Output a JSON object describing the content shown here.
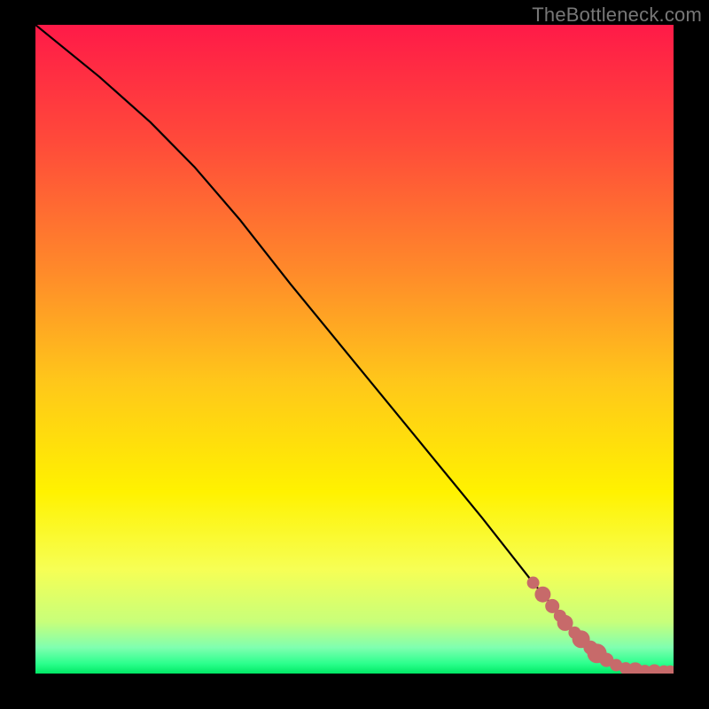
{
  "watermark": "TheBottleneck.com",
  "gradient": {
    "stops": [
      {
        "offset": 0.0,
        "color": "#ff1a48"
      },
      {
        "offset": 0.18,
        "color": "#ff4a3a"
      },
      {
        "offset": 0.38,
        "color": "#ff8a2a"
      },
      {
        "offset": 0.55,
        "color": "#ffc71a"
      },
      {
        "offset": 0.72,
        "color": "#fff200"
      },
      {
        "offset": 0.84,
        "color": "#f6ff55"
      },
      {
        "offset": 0.92,
        "color": "#c8ff7a"
      },
      {
        "offset": 0.96,
        "color": "#7fffb0"
      },
      {
        "offset": 0.985,
        "color": "#2bff8c"
      },
      {
        "offset": 1.0,
        "color": "#00e865"
      }
    ]
  },
  "chart_data": {
    "type": "line",
    "title": "",
    "xlabel": "",
    "ylabel": "",
    "xlim": [
      0,
      100
    ],
    "ylim": [
      0,
      100
    ],
    "series": [
      {
        "name": "curve",
        "x": [
          0,
          10,
          18,
          25,
          32,
          40,
          50,
          60,
          70,
          78,
          84,
          88,
          92,
          95,
          100
        ],
        "y": [
          100,
          92,
          85,
          78,
          70,
          60,
          48,
          36,
          24,
          14,
          7,
          3,
          0.8,
          0.4,
          0.3
        ]
      }
    ],
    "markers": {
      "name": "highlighted-points",
      "color": "#c76a6a",
      "x": [
        78,
        79.5,
        81,
        82.2,
        83,
        84.5,
        85.5,
        87,
        88,
        89.5,
        91,
        92.5,
        94,
        95.5,
        97,
        98.5,
        99.5
      ],
      "y": [
        14,
        12.2,
        10.4,
        8.9,
        7.8,
        6.3,
        5.3,
        4.0,
        3.1,
        2.1,
        1.3,
        0.8,
        0.5,
        0.4,
        0.35,
        0.33,
        0.3
      ],
      "r": [
        7,
        9,
        8,
        7,
        9,
        7,
        10,
        8,
        11,
        8,
        7,
        7,
        9,
        7,
        8,
        7,
        7
      ]
    }
  }
}
